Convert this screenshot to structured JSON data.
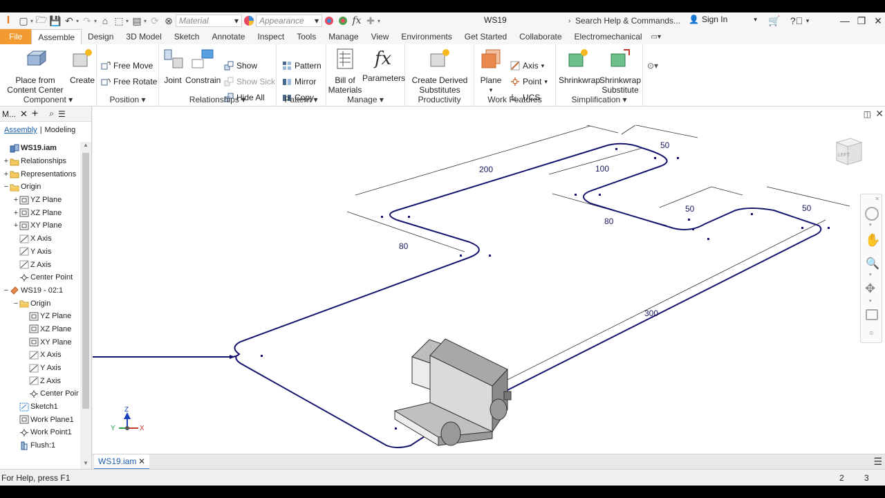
{
  "title_bar": {
    "logo": "I",
    "material_placeholder": "Material",
    "appearance_placeholder": "Appearance",
    "document_title": "WS19",
    "search_text": "Search Help & Commands...",
    "sign_in": "Sign In"
  },
  "ribbon_tabs": [
    "File",
    "Assemble",
    "Design",
    "3D Model",
    "Sketch",
    "Annotate",
    "Inspect",
    "Tools",
    "Manage",
    "View",
    "Environments",
    "Get Started",
    "Collaborate",
    "Electromechanical"
  ],
  "active_tab": "Assemble",
  "ribbon": {
    "component": {
      "label": "Component",
      "place": "Place from\nContent Center",
      "create": "Create"
    },
    "position": {
      "label": "Position",
      "free_move": "Free Move",
      "free_rotate": "Free Rotate"
    },
    "relationships": {
      "label": "Relationships",
      "joint": "Joint",
      "constrain": "Constrain",
      "show": "Show",
      "show_sick": "Show Sick",
      "hide_all": "Hide All"
    },
    "pattern": {
      "label": "Pattern",
      "pattern": "Pattern",
      "mirror": "Mirror",
      "copy": "Copy"
    },
    "manage": {
      "label": "Manage",
      "bom": "Bill of\nMaterials",
      "parameters": "Parameters"
    },
    "productivity": {
      "label": "Productivity",
      "derived": "Create Derived\nSubstitutes"
    },
    "work_features": {
      "label": "Work Features",
      "plane": "Plane",
      "axis": "Axis",
      "point": "Point",
      "ucs": "UCS"
    },
    "simplification": {
      "label": "Simplification",
      "shrinkwrap": "Shrinkwrap",
      "shrinkwrap_sub": "Shrinkwrap\nSubstitute"
    }
  },
  "browser": {
    "header": "M...",
    "assembly_link": "Assembly",
    "modeling_link": "Modeling",
    "tree": [
      {
        "label": "WS19.iam",
        "level": 0,
        "pm": "",
        "icon": "assembly",
        "bold": true
      },
      {
        "label": "Relationships",
        "level": 0,
        "pm": "+",
        "icon": "folder"
      },
      {
        "label": "Representations",
        "level": 0,
        "pm": "+",
        "icon": "folder"
      },
      {
        "label": "Origin",
        "level": 0,
        "pm": "−",
        "icon": "folder-open"
      },
      {
        "label": "YZ Plane",
        "level": 1,
        "pm": "+",
        "icon": "plane"
      },
      {
        "label": "XZ Plane",
        "level": 1,
        "pm": "+",
        "icon": "plane"
      },
      {
        "label": "XY Plane",
        "level": 1,
        "pm": "+",
        "icon": "plane"
      },
      {
        "label": "X Axis",
        "level": 1,
        "pm": "",
        "icon": "axis"
      },
      {
        "label": "Y Axis",
        "level": 1,
        "pm": "",
        "icon": "axis"
      },
      {
        "label": "Z Axis",
        "level": 1,
        "pm": "",
        "icon": "axis"
      },
      {
        "label": "Center Point",
        "level": 1,
        "pm": "",
        "icon": "point"
      },
      {
        "label": "WS19 - 02:1",
        "level": 0,
        "pm": "−",
        "icon": "part"
      },
      {
        "label": "Origin",
        "level": 1,
        "pm": "−",
        "icon": "folder-open"
      },
      {
        "label": "YZ Plane",
        "level": 2,
        "pm": "",
        "icon": "plane"
      },
      {
        "label": "XZ Plane",
        "level": 2,
        "pm": "",
        "icon": "plane"
      },
      {
        "label": "XY Plane",
        "level": 2,
        "pm": "",
        "icon": "plane"
      },
      {
        "label": "X Axis",
        "level": 2,
        "pm": "",
        "icon": "axis"
      },
      {
        "label": "Y Axis",
        "level": 2,
        "pm": "",
        "icon": "axis"
      },
      {
        "label": "Z Axis",
        "level": 2,
        "pm": "",
        "icon": "axis"
      },
      {
        "label": "Center Poir",
        "level": 2,
        "pm": "",
        "icon": "point"
      },
      {
        "label": "Sketch1",
        "level": 1,
        "pm": "",
        "icon": "sketch"
      },
      {
        "label": "Work Plane1",
        "level": 1,
        "pm": "",
        "icon": "plane"
      },
      {
        "label": "Work Point1",
        "level": 1,
        "pm": "",
        "icon": "point"
      },
      {
        "label": "Flush:1",
        "level": 1,
        "pm": "",
        "icon": "constraint"
      }
    ]
  },
  "dimensions": [
    "200",
    "50",
    "100",
    "80",
    "80",
    "50",
    "50",
    "300"
  ],
  "triad": {
    "x": "X",
    "y": "Y",
    "z": "Z"
  },
  "viewcube_label": "LEFT",
  "document_tab": "WS19.iam",
  "status": {
    "help": "For Help, press F1",
    "count_a": "2",
    "count_b": "3"
  },
  "colors": {
    "file_tab": "#f29a2f",
    "path": "#14146e",
    "accent": "#2c7fd6"
  }
}
